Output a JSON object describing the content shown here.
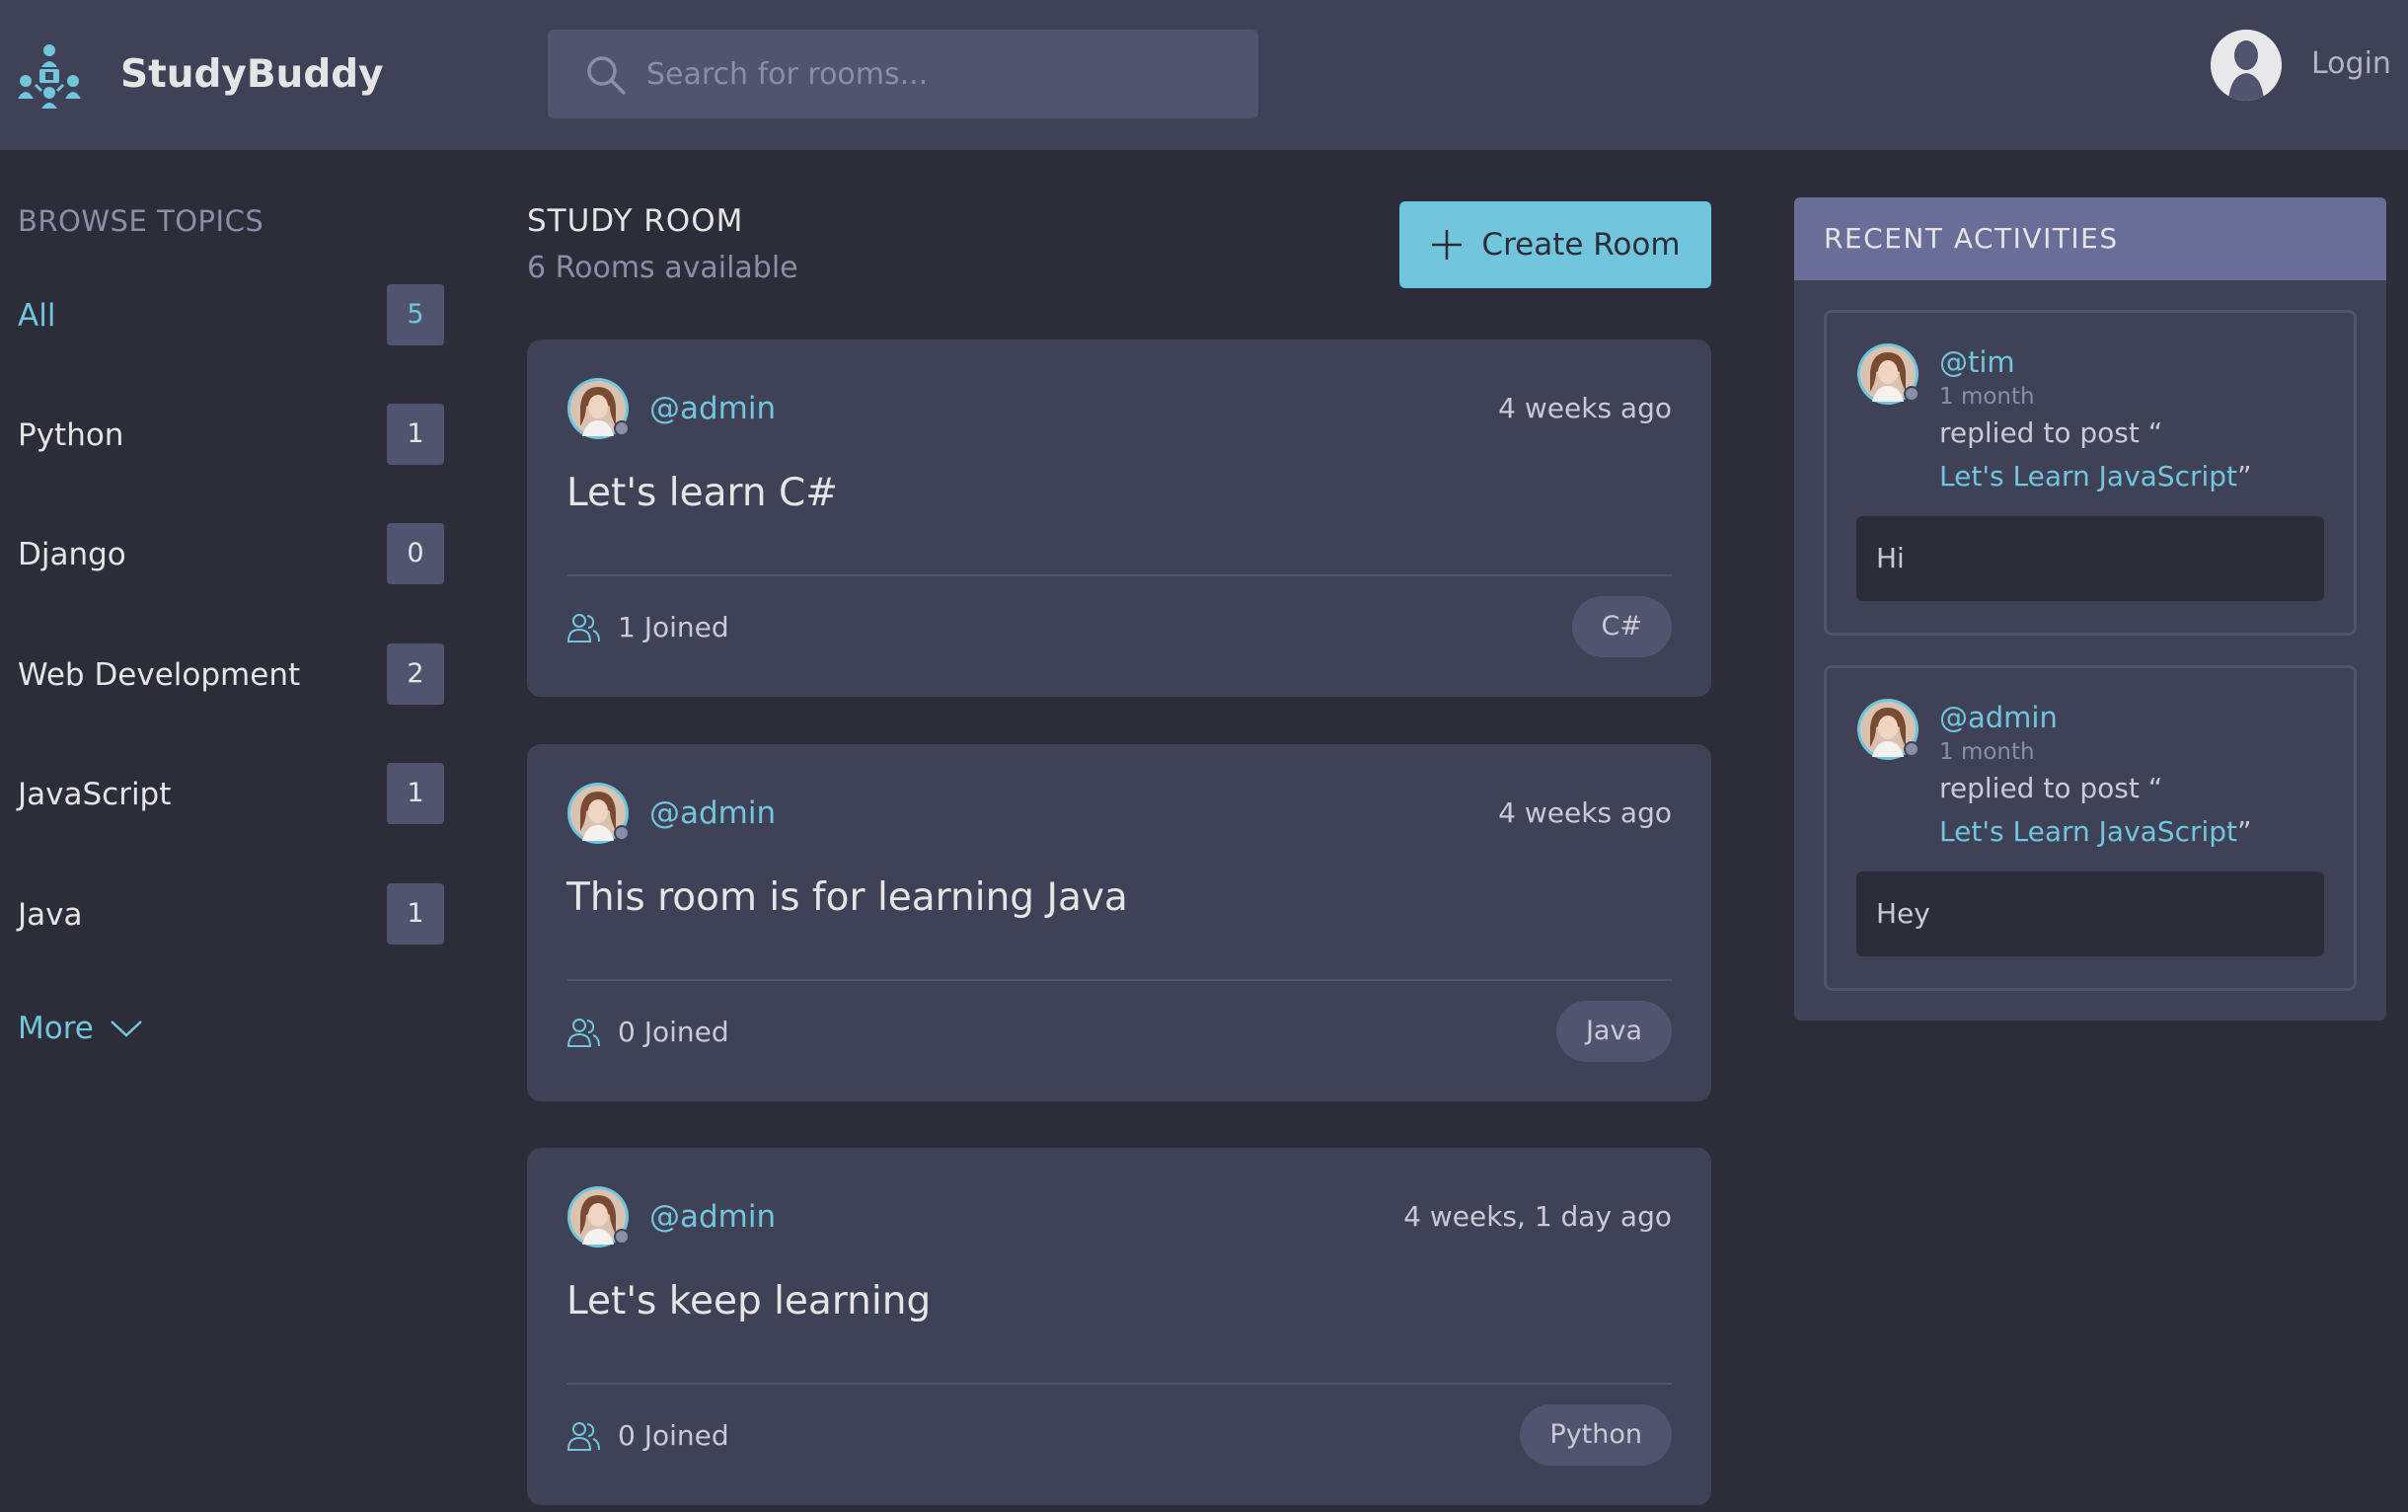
{
  "header": {
    "brand": "StudyBuddy",
    "search_placeholder": "Search for rooms...",
    "login_label": "Login"
  },
  "topics": {
    "title": "BROWSE TOPICS",
    "items": [
      {
        "label": "All",
        "count": "5"
      },
      {
        "label": "Python",
        "count": "1"
      },
      {
        "label": "Django",
        "count": "0"
      },
      {
        "label": "Web Development",
        "count": "2"
      },
      {
        "label": "JavaScript",
        "count": "1"
      },
      {
        "label": "Java",
        "count": "1"
      }
    ],
    "more_label": "More"
  },
  "feed": {
    "heading": "STUDY ROOM",
    "count_text": "6 Rooms available",
    "create_label": "Create Room",
    "rooms": [
      {
        "host": "@admin",
        "time": "4 weeks ago",
        "title": "Let's learn C#",
        "joined": "1 Joined",
        "topic": "C#"
      },
      {
        "host": "@admin",
        "time": "4 weeks ago",
        "title": "This room is for learning Java",
        "joined": "0 Joined",
        "topic": "Java"
      },
      {
        "host": "@admin",
        "time": "4 weeks, 1 day ago",
        "title": "Let's keep learning",
        "joined": "0 Joined",
        "topic": "Python"
      }
    ]
  },
  "activities": {
    "title": "RECENT ACTIVITIES",
    "items": [
      {
        "user": "@tim",
        "time": "1 month",
        "action": "replied to post “",
        "post": "Let's Learn JavaScript",
        "close_quote": "”",
        "message": "Hi"
      },
      {
        "user": "@admin",
        "time": "1 month",
        "action": "replied to post “",
        "post": "Let's Learn JavaScript",
        "close_quote": "”",
        "message": "Hey"
      }
    ]
  },
  "colors": {
    "background": "#2d2d39",
    "panel": "#3f4156",
    "accent": "#71c6dd",
    "muted": "#8b8ea6",
    "activity_header": "#696d97"
  }
}
